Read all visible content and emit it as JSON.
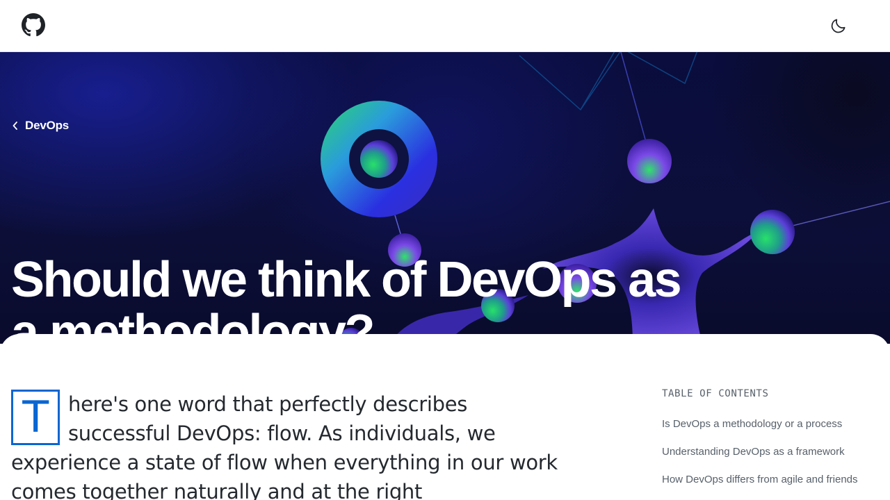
{
  "header": {
    "logo_icon": "github-logo-icon",
    "theme_toggle_icon": "moon-icon"
  },
  "hero": {
    "breadcrumb_label": "DevOps",
    "breadcrumb_icon": "chevron-left-icon",
    "title": "Should we think of DevOps as a methodology?"
  },
  "article": {
    "dropcap": "T",
    "lead": "here's one word that perfectly describes successful DevOps: flow. As individuals, we experience a state of flow when everything in our work comes together naturally and at the right"
  },
  "toc": {
    "heading": "TABLE OF CONTENTS",
    "items": [
      {
        "label": "Is DevOps a methodology or a process"
      },
      {
        "label": "Understanding DevOps as a framework"
      },
      {
        "label": "How DevOps differs from agile and friends"
      }
    ]
  },
  "colors": {
    "accent": "#0a66d1",
    "text": "#24292f",
    "muted": "#57606a",
    "hero_bg": "#0c0f3a"
  }
}
